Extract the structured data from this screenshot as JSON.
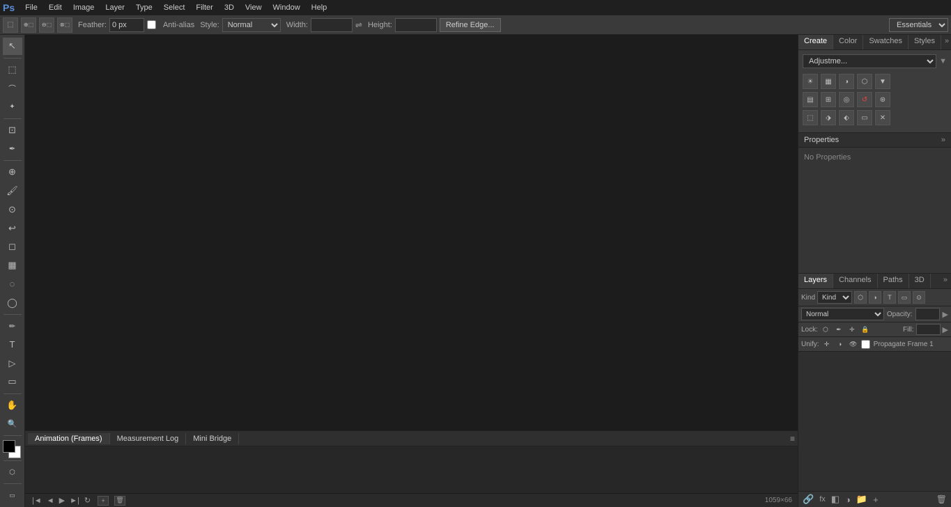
{
  "app": {
    "logo": "Ps",
    "title": "Adobe Photoshop"
  },
  "menu_bar": {
    "items": [
      "File",
      "Edit",
      "Image",
      "Layer",
      "Type",
      "Select",
      "Filter",
      "3D",
      "View",
      "Window",
      "Help"
    ]
  },
  "toolbar": {
    "feather_label": "Feather:",
    "feather_value": "0 px",
    "anti_alias_label": "Anti-alias",
    "style_label": "Style:",
    "style_value": "Normal",
    "width_label": "Width:",
    "height_label": "Height:",
    "refine_edge_btn": "Refine Edge...",
    "workspace_value": "Essentials"
  },
  "left_tools": {
    "tools": [
      {
        "name": "move-tool",
        "icon": "↖",
        "label": "Move"
      },
      {
        "name": "marquee-tool",
        "icon": "⬚",
        "label": "Rectangular Marquee"
      },
      {
        "name": "lasso-tool",
        "icon": "⌒",
        "label": "Lasso"
      },
      {
        "name": "quick-select-tool",
        "icon": "✦",
        "label": "Quick Select"
      },
      {
        "name": "crop-tool",
        "icon": "⊡",
        "label": "Crop"
      },
      {
        "name": "eyedropper-tool",
        "icon": "✒",
        "label": "Eyedropper"
      },
      {
        "name": "healing-tool",
        "icon": "⊕",
        "label": "Healing Brush"
      },
      {
        "name": "brush-tool",
        "icon": "🖌",
        "label": "Brush"
      },
      {
        "name": "clone-tool",
        "icon": "⊙",
        "label": "Clone Stamp"
      },
      {
        "name": "history-brush",
        "icon": "↩",
        "label": "History Brush"
      },
      {
        "name": "eraser-tool",
        "icon": "◻",
        "label": "Eraser"
      },
      {
        "name": "gradient-tool",
        "icon": "▦",
        "label": "Gradient"
      },
      {
        "name": "blur-tool",
        "icon": "◌",
        "label": "Blur"
      },
      {
        "name": "dodge-tool",
        "icon": "◯",
        "label": "Dodge"
      },
      {
        "name": "pen-tool",
        "icon": "✏",
        "label": "Pen"
      },
      {
        "name": "type-tool",
        "icon": "T",
        "label": "Type"
      },
      {
        "name": "path-select",
        "icon": "▷",
        "label": "Path Selection"
      },
      {
        "name": "shape-tool",
        "icon": "▭",
        "label": "Shape"
      },
      {
        "name": "hand-tool",
        "icon": "✋",
        "label": "Hand"
      },
      {
        "name": "zoom-tool",
        "icon": "🔍",
        "label": "Zoom"
      },
      {
        "name": "edit-quick-mask",
        "icon": "⬡",
        "label": "Edit in Quick Mask"
      }
    ],
    "fg_color": "#000000",
    "bg_color": "#ffffff"
  },
  "right_panel": {
    "top_tabs": [
      "Create",
      "Color",
      "Swatches",
      "Styles"
    ],
    "active_top_tab": "Create",
    "adjustments_dropdown": "Adjustme...",
    "adj_icons_row1": [
      "☀",
      "▦",
      "◑",
      "⬡",
      "▼"
    ],
    "adj_icons_row2": [
      "▤",
      "⊞",
      "◎",
      "↺",
      "⊛"
    ],
    "adj_icons_row3": [
      "⬚",
      "⬗",
      "⬖",
      "▭",
      "✕"
    ],
    "properties": {
      "header": "Properties",
      "content": "No Properties"
    },
    "layers": {
      "tabs": [
        "Layers",
        "Channels",
        "Paths",
        "3D"
      ],
      "active_tab": "Layers",
      "kind_label": "Kind",
      "blend_mode": "Normal",
      "opacity_label": "Opacity:",
      "lock_label": "Lock:",
      "fill_label": "Fill:",
      "unify_label": "Unify:",
      "propagate_label": "Propagate Frame 1"
    }
  },
  "bottom_panel": {
    "tabs": [
      "Animation (Frames)",
      "Measurement Log",
      "Mini Bridge"
    ],
    "active_tab": "Animation (Frames)"
  }
}
